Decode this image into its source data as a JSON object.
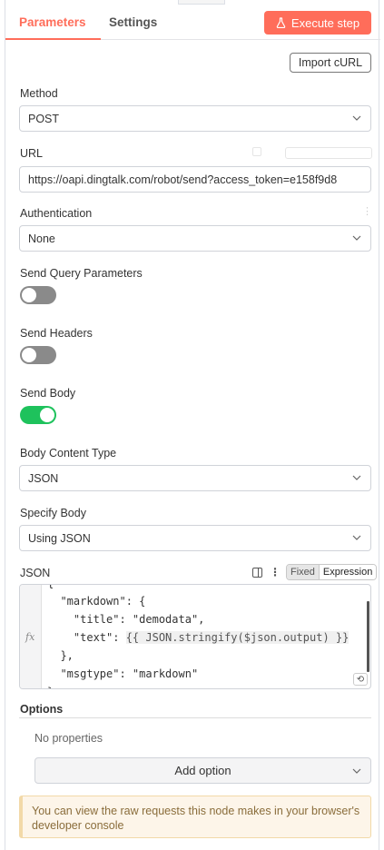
{
  "tabs": {
    "parameters": "Parameters",
    "settings": "Settings"
  },
  "execute_label": "Execute step",
  "import_label": "Import cURL",
  "method": {
    "label": "Method",
    "value": "POST"
  },
  "url": {
    "label": "URL",
    "value": "https://oapi.dingtalk.com/robot/send?access_token=e158f9d8"
  },
  "authentication": {
    "label": "Authentication",
    "value": "None"
  },
  "send_query": {
    "label": "Send Query Parameters",
    "enabled": false
  },
  "send_headers": {
    "label": "Send Headers",
    "enabled": false
  },
  "send_body": {
    "label": "Send Body",
    "enabled": true
  },
  "body_content_type": {
    "label": "Body Content Type",
    "value": "JSON"
  },
  "specify_body": {
    "label": "Specify Body",
    "value": "Using JSON"
  },
  "json": {
    "label": "JSON",
    "mode_fixed": "Fixed",
    "mode_expression": "Expression",
    "gutter_label": "fx",
    "lines": [
      "{",
      "  \"markdown\": {",
      "    \"title\": \"demodata\",",
      "    \"text\": ",
      "  },",
      "  \"msgtype\": \"markdown\"",
      "}"
    ],
    "expression": "{{ JSON.stringify($json.output) }}"
  },
  "options": {
    "title": "Options",
    "empty_text": "No properties",
    "add_label": "Add option"
  },
  "notice_text": "You can view the raw requests this node makes in your browser's developer console",
  "colors": {
    "accent": "#ff6d5a",
    "toggle_on": "#1ec25c",
    "toggle_off": "#8a8a8a",
    "notice_bg": "#fdf5e9"
  }
}
